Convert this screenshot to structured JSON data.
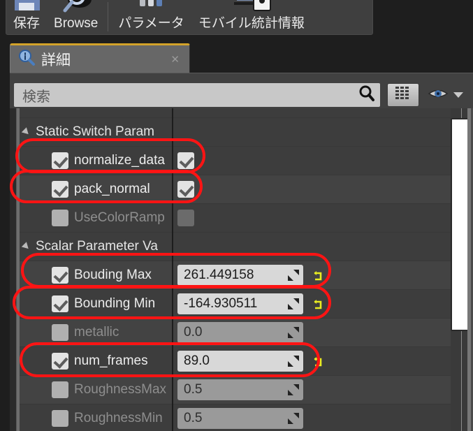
{
  "toolbar": {
    "buttons": [
      {
        "label": "保存",
        "icon": "save-disk-icon"
      },
      {
        "label": "Browse",
        "icon": "magnifier-browse-icon"
      },
      {
        "label": "パラメータ",
        "icon": "parameters-bars-icon"
      },
      {
        "label": "モバイル統計情報",
        "icon": "mobile-stats-icon"
      }
    ]
  },
  "tab": {
    "icon": "details-magnifier-icon",
    "title": "詳細",
    "close_label": "✕"
  },
  "search": {
    "placeholder": "検索",
    "search_icon": "search-icon",
    "grid_button_icon": "column-grid-icon",
    "eye_icon": "eye-visibility-icon",
    "chevron_icon": "chevron-down-icon"
  },
  "groups": [
    {
      "name": "static-switch",
      "label": "Static Switch Param",
      "expanded": true,
      "rows": [
        {
          "name": "normalize_data",
          "checked": true,
          "enabled": true,
          "override": true,
          "kind": "switch",
          "highlighted": true
        },
        {
          "name": "pack_normal",
          "checked": true,
          "enabled": true,
          "override": true,
          "kind": "switch",
          "highlighted": true
        },
        {
          "name": "UseColorRamp",
          "checked": false,
          "enabled": false,
          "override": false,
          "kind": "switch",
          "highlighted": false
        }
      ]
    },
    {
      "name": "scalar-parameter",
      "label": "Scalar Parameter Va",
      "expanded": true,
      "rows": [
        {
          "name": "Bouding Max",
          "checked": true,
          "enabled": true,
          "value": "261.449158",
          "kind": "scalar",
          "reset": true,
          "highlighted": true
        },
        {
          "name": "Bounding Min",
          "checked": true,
          "enabled": true,
          "value": "-164.930511",
          "kind": "scalar",
          "reset": true,
          "highlighted": true
        },
        {
          "name": "metallic",
          "checked": false,
          "enabled": false,
          "value": "0.0",
          "kind": "scalar",
          "reset": false,
          "highlighted": false
        },
        {
          "name": "num_frames",
          "checked": true,
          "enabled": true,
          "value": "89.0",
          "kind": "scalar",
          "reset": true,
          "highlighted": true
        },
        {
          "name": "RoughnessMax",
          "checked": false,
          "enabled": false,
          "value": "0.5",
          "kind": "scalar",
          "reset": false,
          "highlighted": false
        },
        {
          "name": "RoughnessMin",
          "checked": false,
          "enabled": false,
          "value": "0.5",
          "kind": "scalar",
          "reset": false,
          "highlighted": false
        }
      ]
    }
  ],
  "scrollbar": {
    "orientation": "vertical",
    "thumb_name": "vertical-scrollbar-thumb"
  },
  "annotations": {
    "color": "#ff1414",
    "shape": "rounded-rectangle-highlight",
    "targets": [
      "normalize_data",
      "pack_normal",
      "Bouding Max",
      "Bounding Min",
      "num_frames"
    ]
  },
  "colors": {
    "accent_tab": "#d3a32a",
    "panel_bg": "#414141",
    "row_bg": "#3d3d3d",
    "annotation": "#ff1414",
    "reset_arrow": "#e8ec22"
  }
}
